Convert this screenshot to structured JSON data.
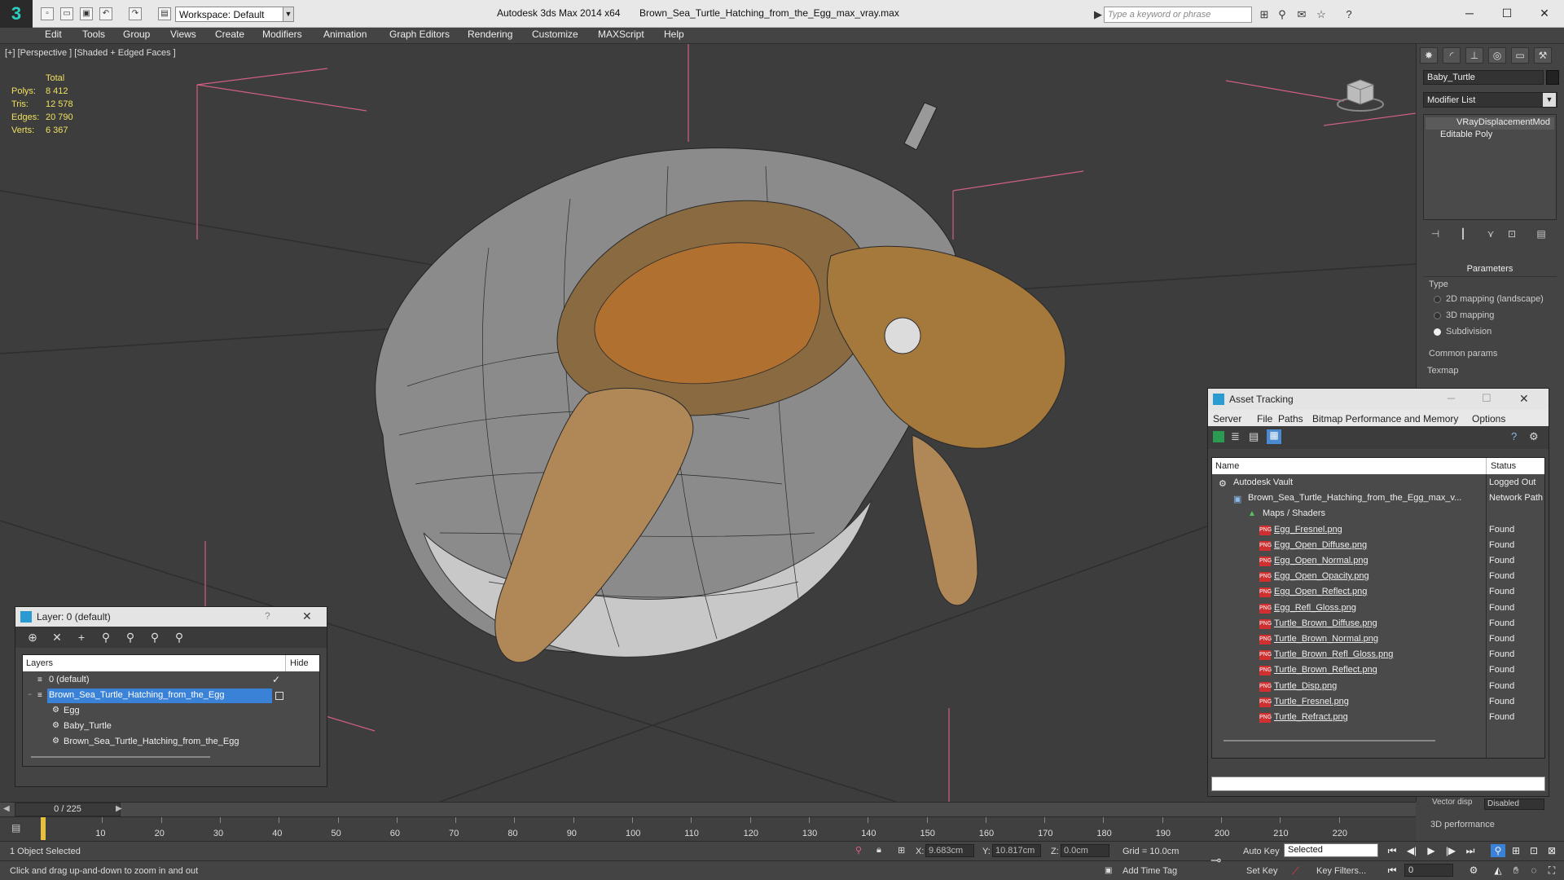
{
  "titlebar": {
    "logo": "3",
    "workspace": "Workspace: Default",
    "app_title": "Autodesk 3ds Max  2014 x64",
    "file_title": "Brown_Sea_Turtle_Hatching_from_the_Egg_max_vray.max",
    "search_placeholder": "Type a keyword or phrase"
  },
  "menu": [
    "Edit",
    "Tools",
    "Group",
    "Views",
    "Create",
    "Modifiers",
    "Animation",
    "Graph Editors",
    "Rendering",
    "Customize",
    "MAXScript",
    "Help"
  ],
  "viewport": {
    "label": "[+] [Perspective ] [Shaded + Edged Faces ]",
    "stats_header": "Total",
    "stats": [
      {
        "label": "Polys:",
        "value": "8 412"
      },
      {
        "label": "Tris:",
        "value": "12 578"
      },
      {
        "label": "Edges:",
        "value": "20 790"
      },
      {
        "label": "Verts:",
        "value": "6 367"
      }
    ]
  },
  "command_panel": {
    "object_name": "Baby_Turtle",
    "modifier_list": "Modifier List",
    "stack": [
      "VRayDisplacementMod",
      "Editable Poly"
    ],
    "parameters_title": "Parameters",
    "type_label": "Type",
    "type_options": [
      "2D mapping (landscape)",
      "3D mapping",
      "Subdivision"
    ],
    "common_params": "Common params",
    "texmap": "Texmap",
    "vector_disp_label": "Vector disp",
    "vector_disp_value": "Disabled",
    "performance": "3D performance"
  },
  "layer_dialog": {
    "title": "Layer: 0 (default)",
    "help": "?",
    "col_layers": "Layers",
    "col_hide": "Hide",
    "rows": [
      {
        "name": "0 (default)",
        "indent": 1
      },
      {
        "name": "Brown_Sea_Turtle_Hatching_from_the_Egg",
        "indent": 1
      },
      {
        "name": "Egg",
        "indent": 2
      },
      {
        "name": "Baby_Turtle",
        "indent": 2
      },
      {
        "name": "Brown_Sea_Turtle_Hatching_from_the_Egg",
        "indent": 2
      }
    ]
  },
  "asset_tracking": {
    "title": "Asset Tracking",
    "menu": [
      "Server",
      "File",
      "Paths",
      "Bitmap Performance and Memory",
      "Options"
    ],
    "col_name": "Name",
    "col_status": "Status",
    "rows": [
      {
        "name": "Autodesk Vault",
        "status": "Logged Out",
        "level": 0
      },
      {
        "name": "Brown_Sea_Turtle_Hatching_from_the_Egg_max_v...",
        "status": "Network Path",
        "level": 1
      },
      {
        "name": "Maps / Shaders",
        "status": "",
        "level": 2
      },
      {
        "name": "Egg_Fresnel.png",
        "status": "Found",
        "level": 3
      },
      {
        "name": "Egg_Open_Diffuse.png",
        "status": "Found",
        "level": 3
      },
      {
        "name": "Egg_Open_Normal.png",
        "status": "Found",
        "level": 3
      },
      {
        "name": "Egg_Open_Opacity.png",
        "status": "Found",
        "level": 3
      },
      {
        "name": "Egg_Open_Reflect.png",
        "status": "Found",
        "level": 3
      },
      {
        "name": "Egg_Refl_Gloss.png",
        "status": "Found",
        "level": 3
      },
      {
        "name": "Turtle_Brown_Diffuse.png",
        "status": "Found",
        "level": 3
      },
      {
        "name": "Turtle_Brown_Normal.png",
        "status": "Found",
        "level": 3
      },
      {
        "name": "Turtle_Brown_Refl_Gloss.png",
        "status": "Found",
        "level": 3
      },
      {
        "name": "Turtle_Brown_Reflect.png",
        "status": "Found",
        "level": 3
      },
      {
        "name": "Turtle_Disp.png",
        "status": "Found",
        "level": 3
      },
      {
        "name": "Turtle_Fresnel.png",
        "status": "Found",
        "level": 3
      },
      {
        "name": "Turtle_Refract.png",
        "status": "Found",
        "level": 3
      }
    ]
  },
  "timeline": {
    "frame": "0 / 225",
    "ticks": [
      "10",
      "20",
      "30",
      "40",
      "50",
      "60",
      "70",
      "80",
      "90",
      "100",
      "110",
      "120",
      "130",
      "140",
      "150",
      "160",
      "170",
      "180",
      "190",
      "200",
      "210",
      "220"
    ]
  },
  "status": {
    "selection": "1 Object Selected",
    "prompt": "Click and drag up-and-down to zoom in and out",
    "x": "9.683cm",
    "y": "10.817cm",
    "z": "0.0cm",
    "grid": "Grid = 10.0cm",
    "add_time_tag": "Add Time Tag",
    "auto_key": "Auto Key",
    "set_key": "Set Key",
    "selected": "Selected",
    "key_filters": "Key Filters...",
    "current_frame": "0"
  },
  "icons": [
    "undo-icon",
    "redo-icon",
    "search-icon",
    "star-icon",
    "help-icon",
    "play-icon",
    "lock-icon"
  ]
}
